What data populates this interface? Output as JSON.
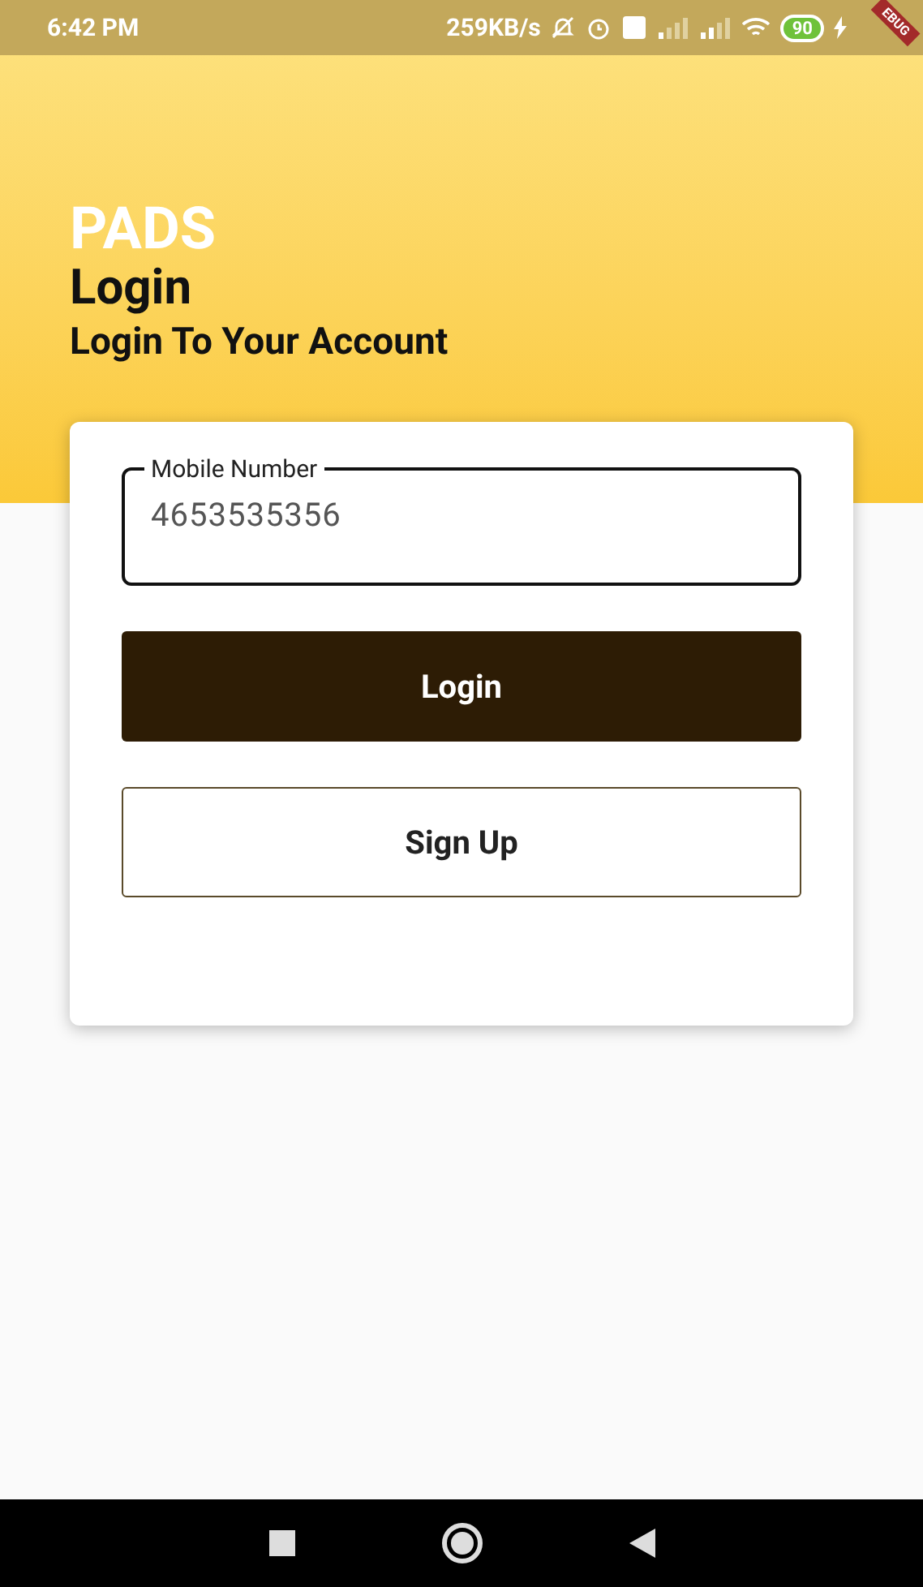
{
  "status_bar": {
    "time": "6:42 PM",
    "speed": "259KB/s",
    "battery": "90",
    "debug_banner": "EBUG"
  },
  "header": {
    "app_name": "PADS",
    "title": "Login",
    "subtitle": "Login To Your Account"
  },
  "form": {
    "field": {
      "label": "Mobile Number",
      "value": "4653535356",
      "focused": true
    },
    "buttons": [
      {
        "label": "Login",
        "kind": "primary"
      },
      {
        "label": "Sign Up",
        "kind": "outline"
      }
    ]
  }
}
